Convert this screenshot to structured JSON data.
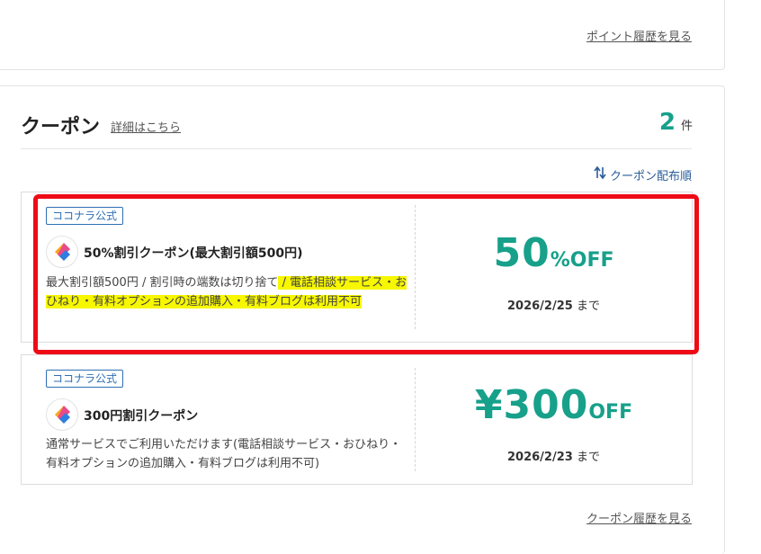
{
  "points": {
    "history_link": "ポイント履歴を見る"
  },
  "coupons_section": {
    "title": "クーポン",
    "details_link": "詳細はこちら",
    "count": "2",
    "count_unit": "件",
    "sort_label": "クーポン配布順",
    "history_link": "クーポン履歴を見る"
  },
  "coupons": [
    {
      "badge": "ココナラ公式",
      "name": "50%割引クーポン(最大割引額500円)",
      "desc_plain": "最大割引額500円 / 割引時の端数は切り捨て",
      "desc_highlight": " / 電話相談サービス・おひねり・有料オプションの追加購入・有料ブログは利用不可",
      "discount_value": "50",
      "discount_unit": "%OFF",
      "expiry_date": "2026/2/25",
      "expiry_suffix": "まで"
    },
    {
      "badge": "ココナラ公式",
      "name": "300円割引クーポン",
      "desc_plain": "通常サービスでご利用いただけます(電話相談サービス・おひねり・有料オプションの追加購入・有料ブログは利用不可)",
      "desc_highlight": "",
      "discount_value": "¥300",
      "discount_unit": "OFF",
      "expiry_date": "2026/2/23",
      "expiry_suffix": "まで"
    }
  ],
  "colors": {
    "accent_green": "#17a08a",
    "badge_blue": "#2e6fb3",
    "highlight_yellow": "#f7f700",
    "annotation_red": "#ee0b16"
  },
  "icons": [
    "sort-arrows-icon",
    "coconala-logo-icon"
  ]
}
